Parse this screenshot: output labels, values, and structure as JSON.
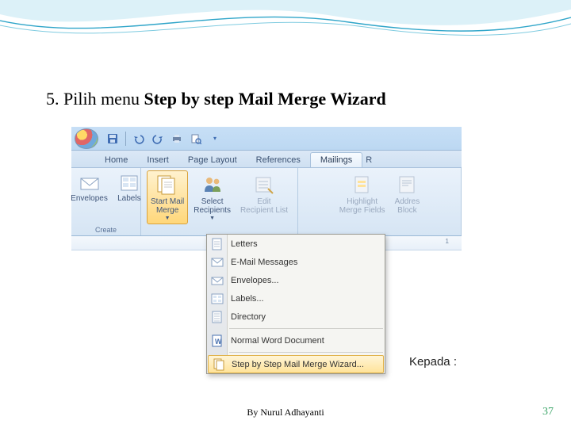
{
  "slide": {
    "instruction_prefix": "5. Pilih menu ",
    "instruction_bold": "Step by step Mail Merge Wizard",
    "author": "By Nurul Adhayanti",
    "page_number": "37"
  },
  "qat": {
    "items": [
      "save-icon",
      "undo-icon",
      "redo-icon",
      "print-icon",
      "preview-icon"
    ]
  },
  "tabs": {
    "items": [
      {
        "label": "Home",
        "active": false
      },
      {
        "label": "Insert",
        "active": false
      },
      {
        "label": "Page Layout",
        "active": false
      },
      {
        "label": "References",
        "active": false
      },
      {
        "label": "Mailings",
        "active": true
      },
      {
        "label": "R",
        "active": false,
        "edge": true
      }
    ]
  },
  "ribbon": {
    "groups": [
      {
        "name": "create",
        "label": "Create",
        "buttons": [
          {
            "id": "envelopes",
            "label": "Envelopes",
            "icon": "envelope-icon",
            "disabled": false,
            "left_clip": true
          },
          {
            "id": "labels",
            "label": "Labels",
            "icon": "labels-icon"
          }
        ]
      },
      {
        "name": "start",
        "label": "",
        "buttons": [
          {
            "id": "start-mail-merge",
            "label_line1": "Start Mail",
            "label_line2": "Merge",
            "icon": "startmerge-icon",
            "active": true,
            "dropdown": true
          },
          {
            "id": "select-recipients",
            "label_line1": "Select",
            "label_line2": "Recipients",
            "icon": "recipients-icon",
            "dropdown": true
          },
          {
            "id": "edit-recipient-list",
            "label_line1": "Edit",
            "label_line2": "Recipient List",
            "icon": "editlist-icon",
            "disabled": true
          }
        ]
      },
      {
        "name": "write",
        "label": "",
        "buttons": [
          {
            "id": "highlight-merge-fields",
            "label_line1": "Highlight",
            "label_line2": "Merge Fields",
            "icon": "highlight-icon",
            "disabled": true
          },
          {
            "id": "address-block",
            "label_line1": "Addres",
            "label_line2": "Block",
            "icon": "address-icon",
            "disabled": true,
            "right_clip": true
          }
        ]
      }
    ]
  },
  "ruler": {
    "mark_1": "1"
  },
  "dropdown": {
    "items": [
      {
        "id": "letters",
        "label": "Letters",
        "icon": "letter-doc-icon"
      },
      {
        "id": "email",
        "label": "E-Mail Messages",
        "icon": "email-icon"
      },
      {
        "id": "envelopes-opt",
        "label": "Envelopes...",
        "icon": "envelope-small-icon"
      },
      {
        "id": "labels-opt",
        "label": "Labels...",
        "icon": "labels-small-icon"
      },
      {
        "id": "directory",
        "label": "Directory",
        "icon": "directory-icon"
      },
      {
        "id": "normal-doc",
        "label": "Normal Word Document",
        "icon": "word-doc-icon"
      },
      {
        "id": "wizard",
        "label": "Step by Step Mail Merge Wizard...",
        "icon": "wizard-icon",
        "hover": true
      }
    ],
    "separators_after": [
      "directory",
      "normal-doc"
    ]
  },
  "doc": {
    "kepada": "Kepada :"
  }
}
